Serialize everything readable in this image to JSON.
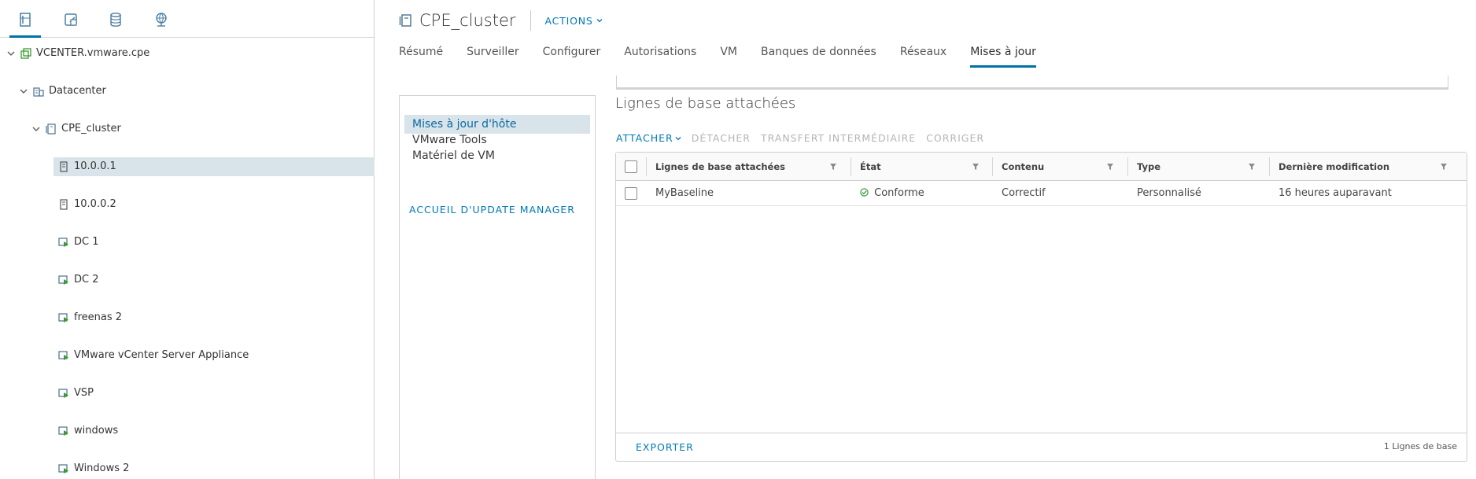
{
  "nav_tabs": [
    {
      "icon": "hosts-clusters-icon",
      "active": true
    },
    {
      "icon": "vms-templates-icon",
      "active": false
    },
    {
      "icon": "storage-icon",
      "active": false
    },
    {
      "icon": "networking-icon",
      "active": false
    }
  ],
  "tree": {
    "items": [
      {
        "label": "VCENTER.vmware.cpe",
        "icon": "vcenter-icon",
        "level": 0,
        "expanded": true
      },
      {
        "label": "Datacenter",
        "icon": "datacenter-icon",
        "level": 1,
        "expanded": true
      },
      {
        "label": "CPE_cluster",
        "icon": "cluster-icon",
        "level": 2,
        "expanded": true
      },
      {
        "label": "10.0.0.1",
        "icon": "host-icon",
        "level": 3,
        "selected": true
      },
      {
        "label": "10.0.0.2",
        "icon": "host-icon",
        "level": 3
      },
      {
        "label": "DC 1",
        "icon": "vm-icon",
        "level": 3
      },
      {
        "label": "DC 2",
        "icon": "vm-icon",
        "level": 3
      },
      {
        "label": "freenas 2",
        "icon": "vm-icon",
        "level": 3
      },
      {
        "label": "VMware vCenter Server Appliance",
        "icon": "vm-icon",
        "level": 3
      },
      {
        "label": "VSP",
        "icon": "vm-icon",
        "level": 3
      },
      {
        "label": "windows",
        "icon": "vm-icon",
        "level": 3
      },
      {
        "label": "Windows 2",
        "icon": "vm-icon",
        "level": 3
      }
    ]
  },
  "header": {
    "title": "CPE_cluster",
    "actions_label": "ACTIONS"
  },
  "main_tabs": [
    {
      "label": "Résumé"
    },
    {
      "label": "Surveiller"
    },
    {
      "label": "Configurer"
    },
    {
      "label": "Autorisations"
    },
    {
      "label": "VM"
    },
    {
      "label": "Banques de données"
    },
    {
      "label": "Réseaux"
    },
    {
      "label": "Mises à jour",
      "active": true
    }
  ],
  "side_nav": {
    "items": [
      {
        "label": "Mises à jour d'hôte",
        "selected": true
      },
      {
        "label": "VMware Tools"
      },
      {
        "label": "Matériel de VM"
      }
    ],
    "update_manager_link": "ACCUEIL D'UPDATE MANAGER"
  },
  "section": {
    "title": "Lignes de base attachées"
  },
  "toolbar": {
    "attach": "ATTACHER",
    "detach": "DÉTACHER",
    "stage": "TRANSFERT INTERMÉDIAIRE",
    "remediate": "CORRIGER"
  },
  "grid": {
    "columns": [
      "Lignes de base attachées",
      "État",
      "Contenu",
      "Type",
      "Dernière modification"
    ],
    "rows": [
      {
        "name": "MyBaseline",
        "state": "Conforme",
        "content": "Correctif",
        "type": "Personnalisé",
        "modified": "16 heures auparavant"
      }
    ],
    "export_label": "EXPORTER",
    "count_label": "1 Lignes de base"
  },
  "colors": {
    "accent": "#0079b8",
    "selection": "#d9e4ea",
    "compliant_green": "#2e8b2e",
    "vm_green": "#3c9a2f"
  }
}
